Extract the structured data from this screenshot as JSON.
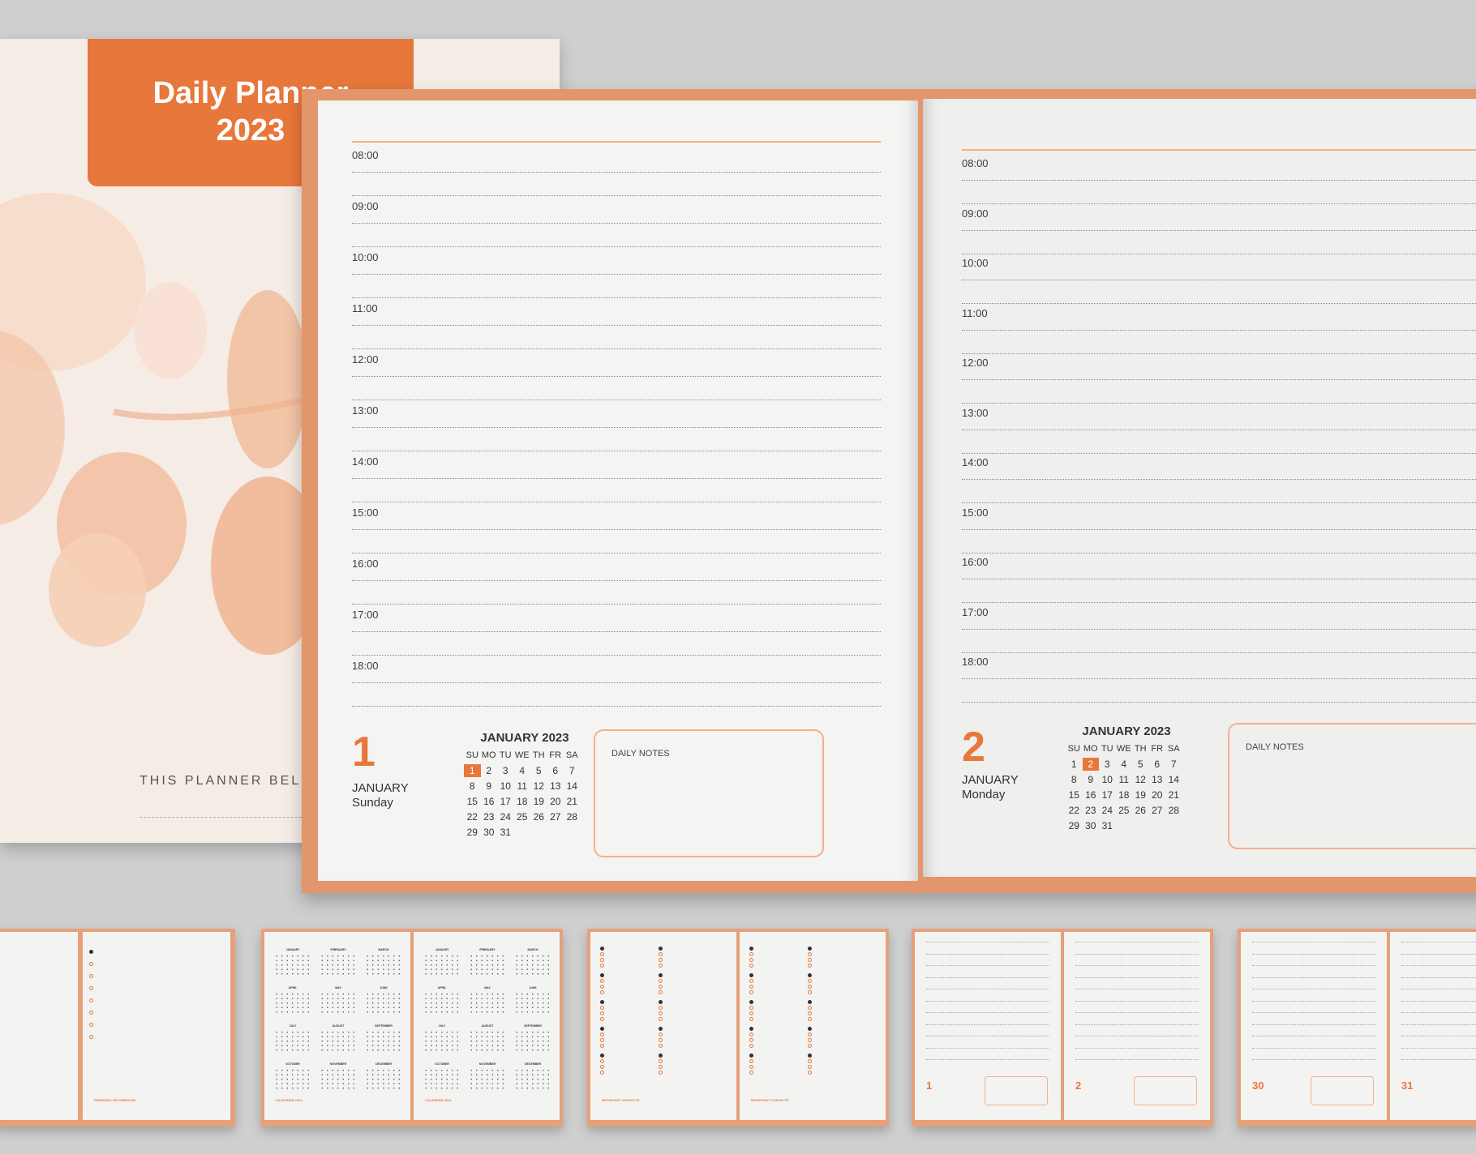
{
  "cover": {
    "title_line1": "Daily Planner",
    "title_line2": "2023",
    "belongs": "THIS PLANNER BELONGS TO"
  },
  "hours": [
    "08:00",
    "09:00",
    "10:00",
    "11:00",
    "12:00",
    "13:00",
    "14:00",
    "15:00",
    "16:00",
    "17:00",
    "18:00"
  ],
  "left_page": {
    "day_number": "1",
    "month": "JANUARY",
    "weekday": "Sunday",
    "selected_date": 1,
    "notes_label": "DAILY NOTES"
  },
  "right_page": {
    "day_number": "2",
    "month": "JANUARY",
    "weekday": "Monday",
    "selected_date": 2,
    "notes_label": "DAILY NOTES"
  },
  "mini_calendar": {
    "title": "JANUARY 2023",
    "weekdays": [
      "SU",
      "MO",
      "TU",
      "WE",
      "TH",
      "FR",
      "SA"
    ],
    "days": 31,
    "start_offset": 0
  },
  "thumbnails": {
    "personal": "PERSONAL INFORMATION",
    "calendar_2023": "CALENDAR 2023",
    "calendar_2024": "CALENDAR 2024",
    "contacts": "IMPORTANT CONTACTS",
    "t4_left_day": "1",
    "t4_right_day": "2",
    "t5_left_day": "30",
    "t5_right_day": "31",
    "months": [
      "JANUARY",
      "FEBRUARY",
      "MARCH",
      "APRIL",
      "MAY",
      "JUNE",
      "JULY",
      "AUGUST",
      "SEPTEMBER",
      "OCTOBER",
      "NOVEMBER",
      "DECEMBER"
    ]
  },
  "colors": {
    "accent": "#e8773b",
    "accent_light": "#f4b08a",
    "book_edge": "#e3966b"
  }
}
